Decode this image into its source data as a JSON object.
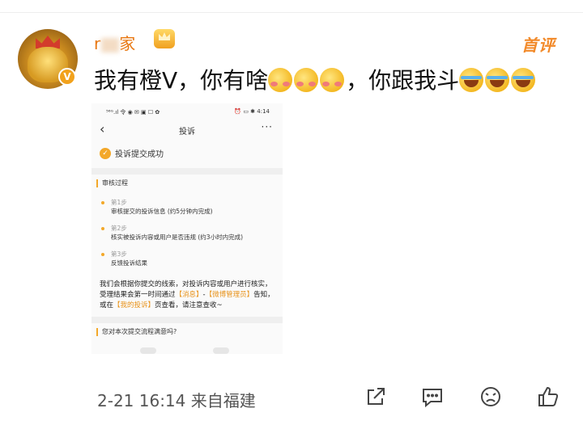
{
  "post": {
    "username_part1": "r",
    "username_part2": "家",
    "first_badge": "首评",
    "text": "我有橙V，你有啥",
    "text_part2": "，你跟我斗",
    "meta": "2-21 16:14  来自福建"
  },
  "embedded": {
    "status_left": "⁵⁶ᴳ.ıl 令 ◉ ✉ ▣ ☐ ✿",
    "status_right": "⏰ ▭ ✱ 4:14",
    "back_icon": "chevron-left-icon",
    "title": "投诉",
    "more": "···",
    "success": "投诉提交成功",
    "review_title": "审核过程",
    "steps": [
      {
        "label": "第1步",
        "desc": "审核提交的投诉信息 (约5分钟内完成)"
      },
      {
        "label": "第2步",
        "desc": "核实被投诉内容或用户是否违规 (约3小时内完成)"
      },
      {
        "label": "第3步",
        "desc": "反馈投诉结果"
      }
    ],
    "paragraph_a": "我们会根据你提交的线索，对投诉内容或用户进行核实，受理结果会第一时间通过",
    "link_messages": "【消息】",
    "paragraph_b": "-",
    "link_admin": "【微博管理员】",
    "paragraph_c": "告知，或在",
    "link_my_complaints": "【我的投诉】",
    "paragraph_d": "页查看，请注意查收~",
    "feedback": "您对本次提交流程满意吗?"
  },
  "actions": [
    "share-icon",
    "comment-icon",
    "dislike-icon",
    "like-icon"
  ],
  "colors": {
    "accent_orange": "#f28a2a",
    "text": "#111111",
    "meta_gray": "#555555",
    "check_orange": "#f3a82a"
  }
}
